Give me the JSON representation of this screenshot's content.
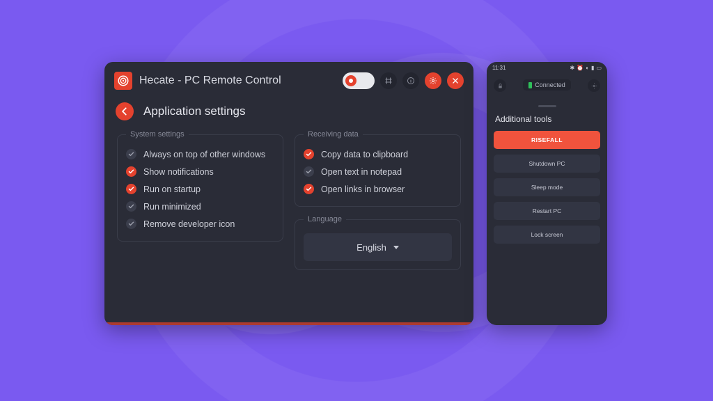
{
  "window": {
    "title": "Hecate - PC Remote Control",
    "page_title": "Application settings",
    "groups": {
      "system": {
        "legend": "System settings",
        "opts": [
          {
            "label": "Always on top of other windows",
            "on": false
          },
          {
            "label": "Show notifications",
            "on": true
          },
          {
            "label": "Run on startup",
            "on": true
          },
          {
            "label": "Run minimized",
            "on": false
          },
          {
            "label": "Remove developer icon",
            "on": false
          }
        ]
      },
      "receiving": {
        "legend": "Receiving data",
        "opts": [
          {
            "label": "Copy data to clipboard",
            "on": true
          },
          {
            "label": "Open text in notepad",
            "on": false
          },
          {
            "label": "Open links in browser",
            "on": true
          }
        ]
      },
      "language": {
        "legend": "Language",
        "selected": "English"
      }
    }
  },
  "phone": {
    "status_time": "11:31",
    "connection": "Connected",
    "section_title": "Additional tools",
    "buttons": [
      {
        "label": "RISEFALL",
        "accent": true
      },
      {
        "label": "Shutdown PC",
        "accent": false
      },
      {
        "label": "Sleep mode",
        "accent": false
      },
      {
        "label": "Restart PC",
        "accent": false
      },
      {
        "label": "Lock screen",
        "accent": false
      }
    ]
  },
  "colors": {
    "accent": "#e4422e",
    "panel": "#2a2c37"
  }
}
